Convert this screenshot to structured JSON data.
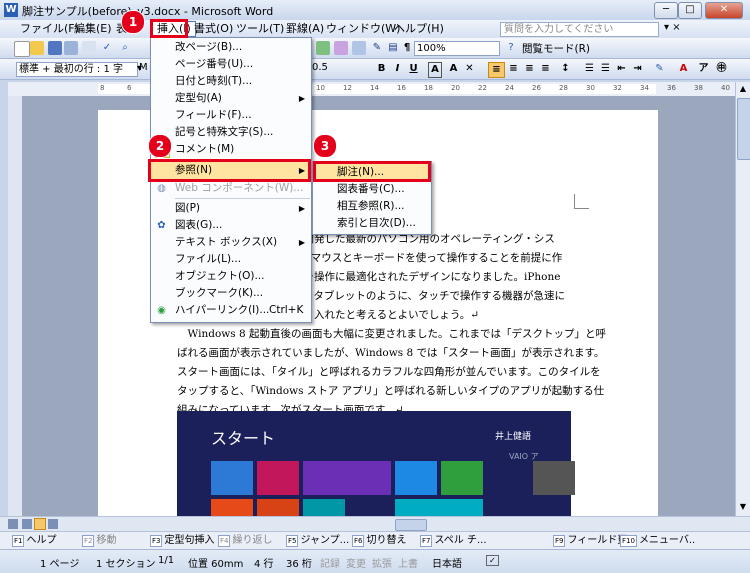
{
  "window": {
    "title": "脚注サンプル(before)_v3.docx - Microsoft Word",
    "minimize": "─",
    "maximize": "□",
    "close": "✕"
  },
  "menubar": {
    "items": [
      "ファイル(F)",
      "編集(E)",
      "表",
      "挿入(I)",
      "書式(O)",
      "ツール(T)",
      "罫線(A)",
      "ウィンドウ(W)",
      "ヘルプ(H)"
    ],
    "help_placeholder": "質問を入力してください"
  },
  "toolbar1": {
    "zoom": "100%",
    "reading_mode": "閲覧モード(R)"
  },
  "toolbar2": {
    "style": "標準 + 最初の行 : 1 字",
    "font_partial": "M",
    "size_partial": "0.5",
    "bold": "B",
    "italic": "I",
    "underline": "U"
  },
  "ruler": {
    "labels": [
      "8",
      "6",
      "4",
      "2",
      "2",
      "4",
      "6",
      "8",
      "10",
      "12",
      "14",
      "16",
      "18",
      "20",
      "22",
      "24",
      "26",
      "28",
      "30",
      "32",
      "34",
      "36",
      "38",
      "40"
    ]
  },
  "insert_menu": {
    "items": [
      {
        "label": "改ページ(B)...",
        "submenu": false,
        "disabled": false
      },
      {
        "label": "ページ番号(U)...",
        "submenu": false,
        "disabled": false
      },
      {
        "label": "日付と時刻(T)...",
        "submenu": false,
        "disabled": false
      },
      {
        "label": "定型句(A)",
        "submenu": true,
        "disabled": false
      },
      {
        "label": "フィールド(F)...",
        "submenu": false,
        "disabled": false
      },
      {
        "label": "記号と特殊文字(S)...",
        "submenu": false,
        "disabled": false
      },
      {
        "label": "コメント(M)",
        "submenu": false,
        "disabled": false
      },
      {
        "label": "参照(N)",
        "submenu": true,
        "disabled": false
      },
      {
        "label": "Web コンポーネント(W)...",
        "submenu": false,
        "disabled": true
      },
      {
        "label": "図(P)",
        "submenu": true,
        "disabled": false
      },
      {
        "label": "図表(G)...",
        "submenu": false,
        "disabled": false
      },
      {
        "label": "テキスト ボックス(X)",
        "submenu": true,
        "disabled": false
      },
      {
        "label": "ファイル(L)...",
        "submenu": false,
        "disabled": false
      },
      {
        "label": "オブジェクト(O)...",
        "submenu": false,
        "disabled": false
      },
      {
        "label": "ブックマーク(K)...",
        "submenu": false,
        "disabled": false
      },
      {
        "label": "ハイパーリンク(I)...",
        "submenu": false,
        "disabled": false
      }
    ],
    "hyperlink_shortcut": "Ctrl+K"
  },
  "reference_submenu": {
    "items": [
      "脚注(N)...",
      "図表番号(C)...",
      "相互参照(R)...",
      "索引と目次(D)..."
    ]
  },
  "badges": [
    "1",
    "2",
    "3"
  ],
  "document": {
    "para1_tail": [
      "フトが開発した最新のパソコン用のオペレーティング・シス",
      "ws は、マウスとキーボードを使って操作することを前提に作",
      "はタッチ操作に最適化されたデザインになりました。iPhone",
      "フォン、タブレットのように、タッチで操作する機器が急速に",
      "れを取り入れたと考えるとよいでしょう。↵"
    ],
    "para2": [
      "　Windows 8 起動直後の画面も大幅に変更されました。これまでは「デスクトップ」と呼",
      "ばれる画面が表示されていましたが、Windows 8 では「スタート画面」が表示されます。",
      "スタート画面には、「タイル」と呼ばれるカラフルな四角形が並んでいます。このタイルを",
      "タップすると、「Windows ストア アプリ」と呼ばれる新しいタイプのアプリが起動する仕",
      "組みになっています。次がスタート画面です。↵"
    ],
    "screenshot": {
      "title": "スタート",
      "user": "井上健語",
      "vaio": "VAIO ア"
    }
  },
  "function_keys": [
    {
      "n": "F1",
      "label": "ヘルプ"
    },
    {
      "n": "F2",
      "label": "移動"
    },
    {
      "n": "F3",
      "label": "定型句挿入"
    },
    {
      "n": "F4",
      "label": "繰り返し"
    },
    {
      "n": "F5",
      "label": "ジャンプ..."
    },
    {
      "n": "F6",
      "label": "切り替え"
    },
    {
      "n": "F7",
      "label": "スペル チ..."
    },
    {
      "n": "F9",
      "label": "フィールド更"
    },
    {
      "n": "F10",
      "label": "メニューバ.."
    }
  ],
  "status": {
    "page": "1 ページ",
    "section": "1 セクション",
    "pages": "1/1",
    "position": "位置 60mm",
    "line": "4 行",
    "column": "36 桁",
    "rec": "記録",
    "trk": "変更",
    "ext": "拡張",
    "ovr": "上書",
    "lang": "日本語"
  },
  "colors": {
    "accent_red": "#e4001b",
    "highlight": "#5478bf"
  }
}
